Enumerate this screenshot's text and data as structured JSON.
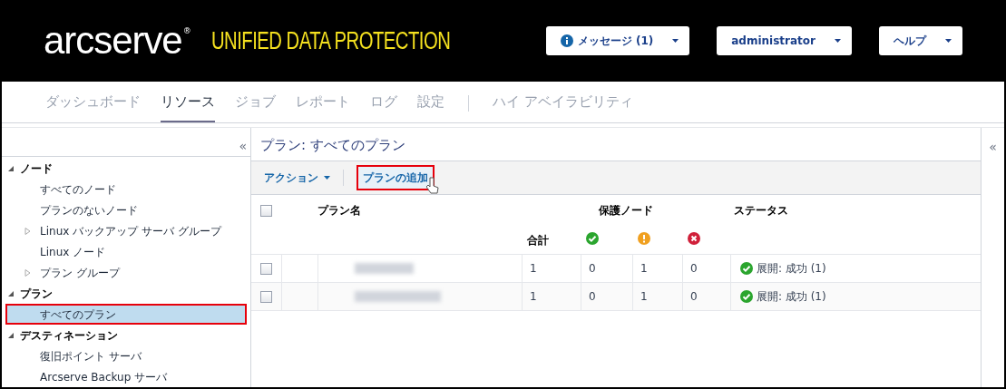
{
  "header": {
    "logo": "arcserve",
    "logo_mark": "®",
    "product": "UNIFIED DATA PROTECTION",
    "buttons": [
      {
        "label": "メッセージ (1)"
      },
      {
        "label": "administrator"
      },
      {
        "label": "ヘルプ"
      }
    ]
  },
  "nav": {
    "items": [
      {
        "label": "ダッシュボード",
        "selected": false
      },
      {
        "label": "リソース",
        "selected": true
      },
      {
        "label": "ジョブ",
        "selected": false
      },
      {
        "label": "レポート",
        "selected": false
      },
      {
        "label": "ログ",
        "selected": false
      },
      {
        "label": "設定",
        "selected": false
      },
      {
        "label": "ハイ アベイラビリティ",
        "selected": false
      }
    ]
  },
  "sidebar": {
    "collapse": "«",
    "sections": [
      {
        "label": "ノード",
        "expanded": true,
        "children": [
          {
            "label": "すべてのノード",
            "kind": "item",
            "selected": false
          },
          {
            "label": "プランのないノード",
            "kind": "item",
            "selected": false
          },
          {
            "label": "Linux バックアップ サーバ グループ",
            "kind": "group",
            "expanded": false,
            "selected": false
          },
          {
            "label": "Linux ノード",
            "kind": "item",
            "selected": false
          },
          {
            "label": "プラン グループ",
            "kind": "group",
            "expanded": false,
            "selected": false
          }
        ]
      },
      {
        "label": "プラン",
        "expanded": true,
        "children": [
          {
            "label": "すべてのプラン",
            "kind": "item",
            "selected": true
          }
        ]
      },
      {
        "label": "デスティネーション",
        "expanded": true,
        "children": [
          {
            "label": "復旧ポイント サーバ",
            "kind": "item",
            "selected": false
          },
          {
            "label": "Arcserve Backup サーバ",
            "kind": "item",
            "selected": false
          }
        ]
      }
    ]
  },
  "main": {
    "title": "プラン: すべてのプラン",
    "toolbar": {
      "action": "アクション",
      "add": "プランの追加"
    },
    "table": {
      "columns": {
        "name": "プラン名",
        "group": "保護ノード",
        "status": "ステータス",
        "total": "合計"
      },
      "select_all_checked": false,
      "rows": [
        {
          "checked": false,
          "total": "1",
          "ok": "0",
          "warning": "1",
          "error": "0",
          "status": {
            "kind": "ok",
            "text": "展開: 成功 (1)"
          }
        },
        {
          "checked": false,
          "total": "1",
          "ok": "0",
          "warning": "1",
          "error": "0",
          "status": {
            "kind": "ok",
            "text": "展開: 成功 (1)"
          }
        }
      ]
    }
  },
  "right_panel": {
    "collapse": "«"
  }
}
